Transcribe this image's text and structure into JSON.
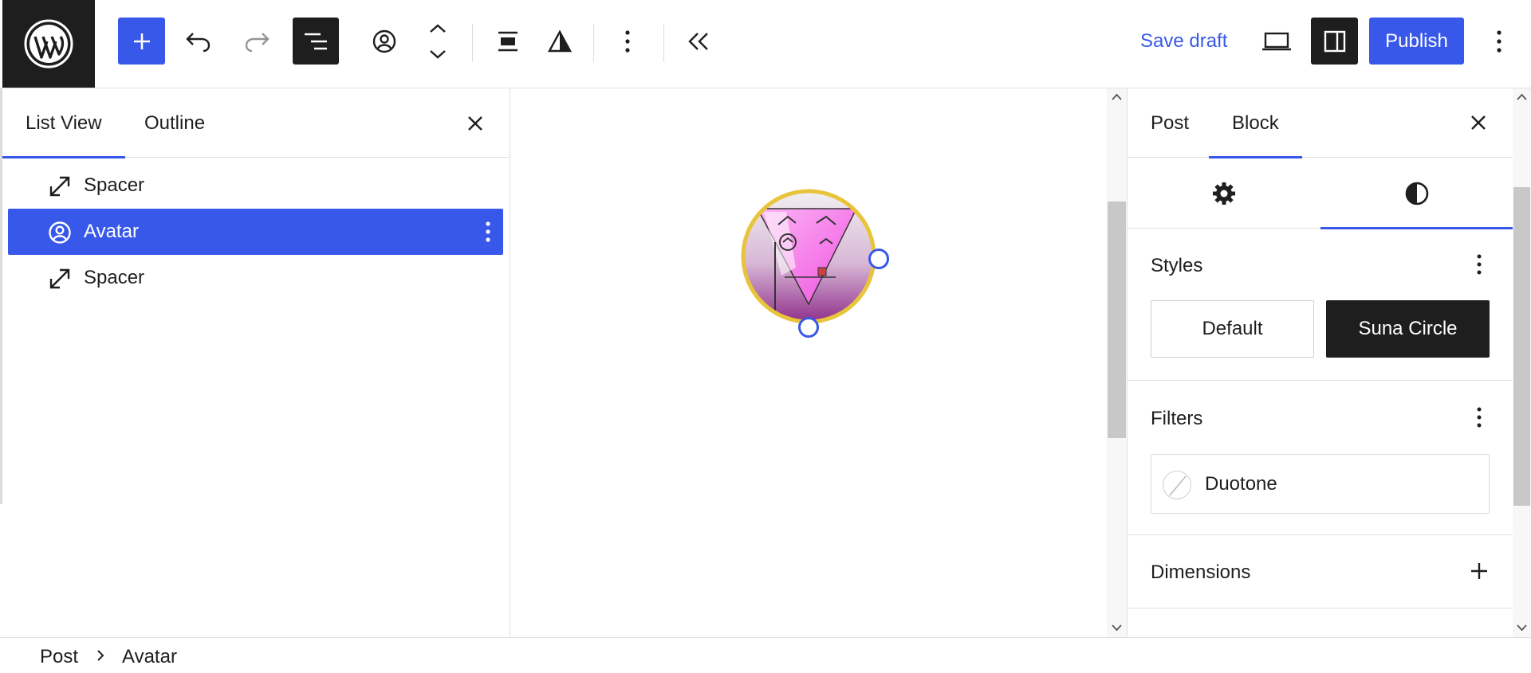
{
  "toolbar": {
    "logo": "wordpress-logo",
    "save_draft": "Save draft",
    "publish": "Publish",
    "icons": [
      "plus-icon",
      "undo-icon",
      "redo-icon",
      "document-overview-icon",
      "avatar-block-icon",
      "move-up-down-icon",
      "align-icon",
      "duotone-filter-icon",
      "more-vertical-icon",
      "collapse-icon",
      "desktop-preview-icon",
      "settings-sidebar-icon",
      "options-icon"
    ]
  },
  "list_panel": {
    "tabs": [
      "List View",
      "Outline"
    ],
    "active_tab": "List View",
    "items": [
      {
        "label": "Spacer",
        "icon": "resize-icon",
        "selected": false
      },
      {
        "label": "Avatar",
        "icon": "avatar-icon",
        "selected": true
      },
      {
        "label": "Spacer",
        "icon": "resize-icon",
        "selected": false
      }
    ]
  },
  "settings_panel": {
    "tabs": [
      "Post",
      "Block"
    ],
    "active_tab": "Block",
    "subtabs": [
      "settings-gear-icon",
      "styles-contrast-icon"
    ],
    "active_subtab": "styles-contrast-icon",
    "styles": {
      "title": "Styles",
      "options": [
        "Default",
        "Suna Circle"
      ],
      "selected": "Suna Circle"
    },
    "filters": {
      "title": "Filters",
      "duotone_label": "Duotone"
    },
    "dimensions": {
      "title": "Dimensions"
    }
  },
  "breadcrumb": [
    "Post",
    "Avatar"
  ],
  "colors": {
    "accent": "#3858e9",
    "dark": "#1e1e1e",
    "avatar_border": "#e8c43a"
  }
}
